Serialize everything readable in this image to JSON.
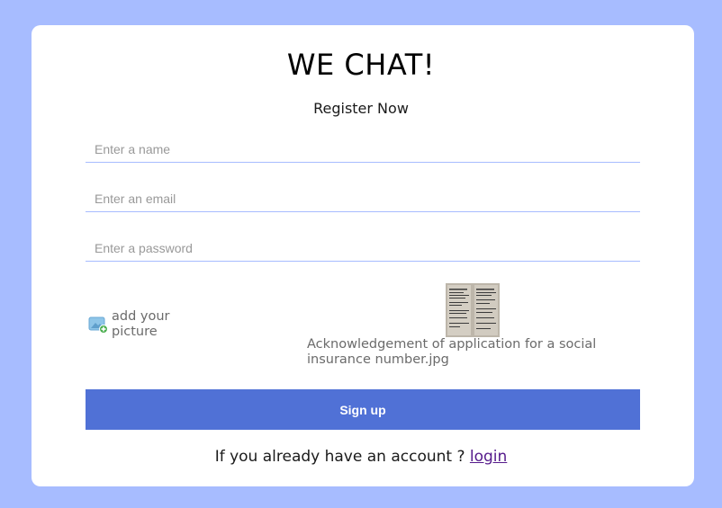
{
  "app": {
    "title": "WE CHAT!",
    "subtitle": "Register Now"
  },
  "form": {
    "name_placeholder": "Enter a name",
    "email_placeholder": "Enter an email",
    "password_placeholder": "Enter a password",
    "avatar_label": "add your picture",
    "selected_file": "Acknowledgement of application for a social insurance number.jpg",
    "signup_label": "Sign up"
  },
  "footer": {
    "prompt": "If you already have an account ? ",
    "login_link": "login"
  },
  "icons": {
    "avatar": "add-image-icon"
  },
  "colors": {
    "background": "#a7bcff",
    "accent": "#5071d6",
    "card": "#ffffff"
  }
}
